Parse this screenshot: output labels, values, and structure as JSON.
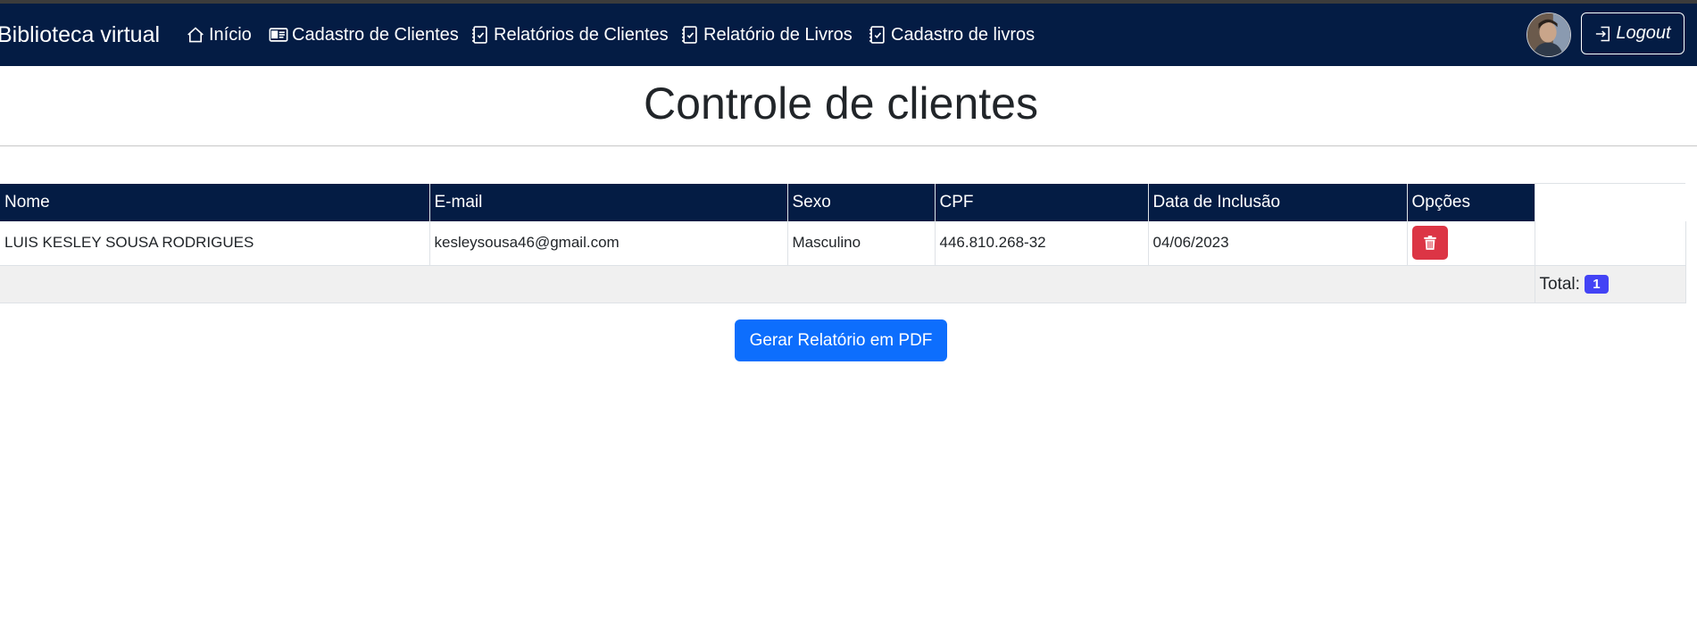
{
  "navbar": {
    "brand": "Biblioteca virtual",
    "items": [
      {
        "label": "Início",
        "icon": "house-icon"
      },
      {
        "label": "Cadastro de Clientes",
        "icon": "id-card-icon"
      },
      {
        "label": "Relatórios de Clientes",
        "icon": "checklist-icon"
      },
      {
        "label": "Relatório de Livros",
        "icon": "checklist-icon"
      },
      {
        "label": "Cadastro de livros",
        "icon": "checklist-icon"
      }
    ],
    "logout_label": "Logout"
  },
  "page": {
    "title": "Controle de clientes"
  },
  "table": {
    "headers": [
      "Nome",
      "E-mail",
      "Sexo",
      "CPF",
      "Data de Inclusão",
      "Opções"
    ],
    "rows": [
      {
        "nome": "LUIS KESLEY SOUSA RODRIGUES",
        "email": "kesleysousa46@gmail.com",
        "sexo": "Masculino",
        "cpf": "446.810.268-32",
        "data_inclusao": "04/06/2023"
      }
    ],
    "total_label": "Total:",
    "total_count": "1"
  },
  "actions": {
    "pdf_button_label": "Gerar Relatório em PDF"
  },
  "colors": {
    "navbar_bg": "#041c44",
    "primary_button": "#0d6efd",
    "danger_button": "#dc3545",
    "badge": "#4343f5"
  }
}
